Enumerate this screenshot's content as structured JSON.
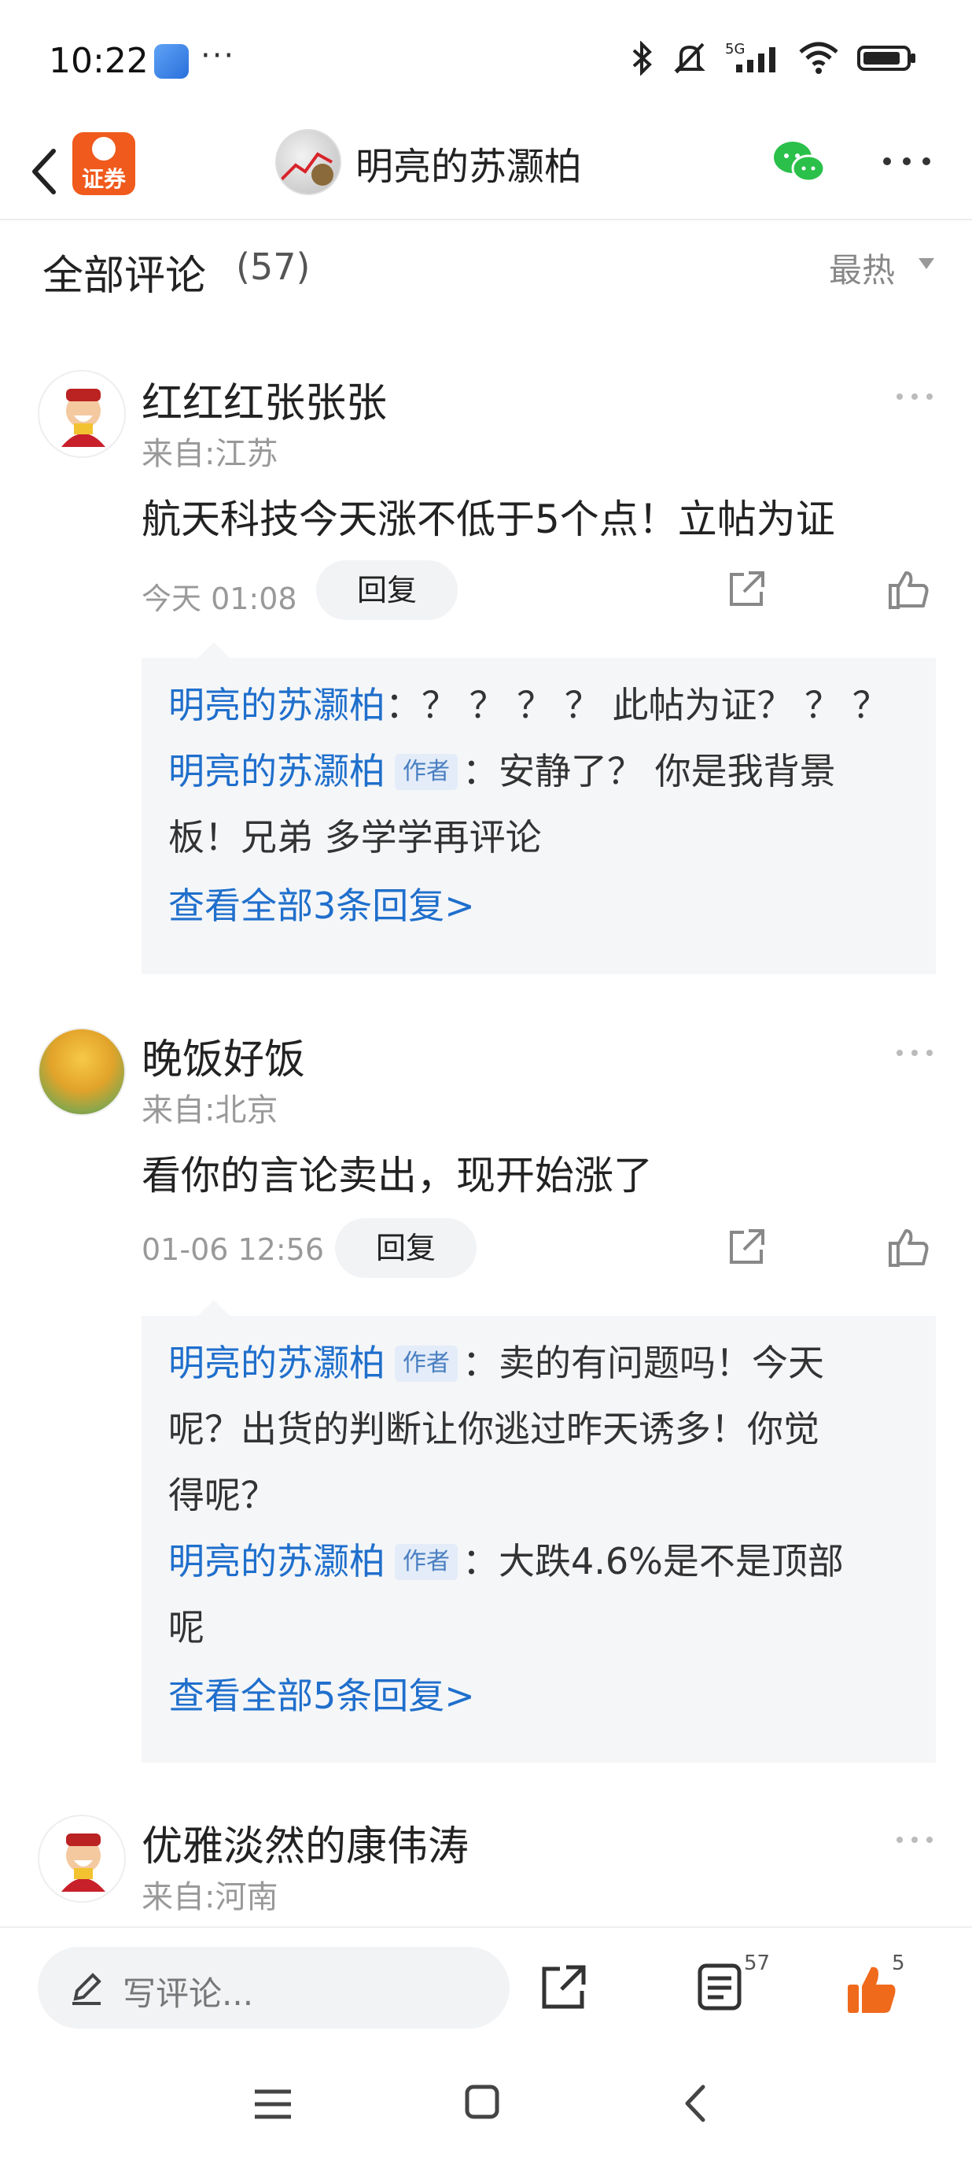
{
  "status_bar": {
    "time": "10:22",
    "dots": "···",
    "network": "5G"
  },
  "nav": {
    "brand_text": "证券",
    "title": "明亮的苏灏柏"
  },
  "header": {
    "title": "全部评论",
    "count": "(57)",
    "sort_label": "最热"
  },
  "comments": [
    {
      "name": "红红红张张张",
      "location": "来自:江苏",
      "text": "航天科技今天涨不低于5个点！立帖为证",
      "time": "今天 01:08",
      "reply_label": "回复",
      "replies": [
        {
          "name": "明亮的苏灏柏",
          "author": false,
          "text": "：？ ？ ？ ？ 此帖为证？ ？ ？"
        },
        {
          "name": "明亮的苏灏柏",
          "author": true,
          "tag": "作者",
          "text": "：安静了？ 你是我背景",
          "text2": "板！兄弟 多学学再评论"
        }
      ],
      "view_all": "查看全部3条回复>"
    },
    {
      "name": "晚饭好饭",
      "location": "来自:北京",
      "text": "看你的言论卖出，现开始涨了",
      "time": "01-06 12:56",
      "reply_label": "回复",
      "replies": [
        {
          "name": "明亮的苏灏柏",
          "author": true,
          "tag": "作者",
          "text": "：卖的有问题吗！今天",
          "text2": "呢？出货的判断让你逃过昨天诱多！你觉",
          "text3": "得呢？"
        },
        {
          "name": "明亮的苏灏柏",
          "author": true,
          "tag": "作者",
          "text": "：大跌4.6%是不是顶部",
          "text2": "呢"
        }
      ],
      "view_all": "查看全部5条回复>"
    },
    {
      "name": "优雅淡然的康伟涛",
      "location": "来自:河南"
    }
  ],
  "bottom_bar": {
    "input_placeholder": "写评论...",
    "comment_count": "57",
    "like_count": "5"
  },
  "colors": {
    "accent_blue": "#1f6fcc",
    "like_orange": "#f06a1c",
    "brand_orange": "#f05a1c"
  }
}
